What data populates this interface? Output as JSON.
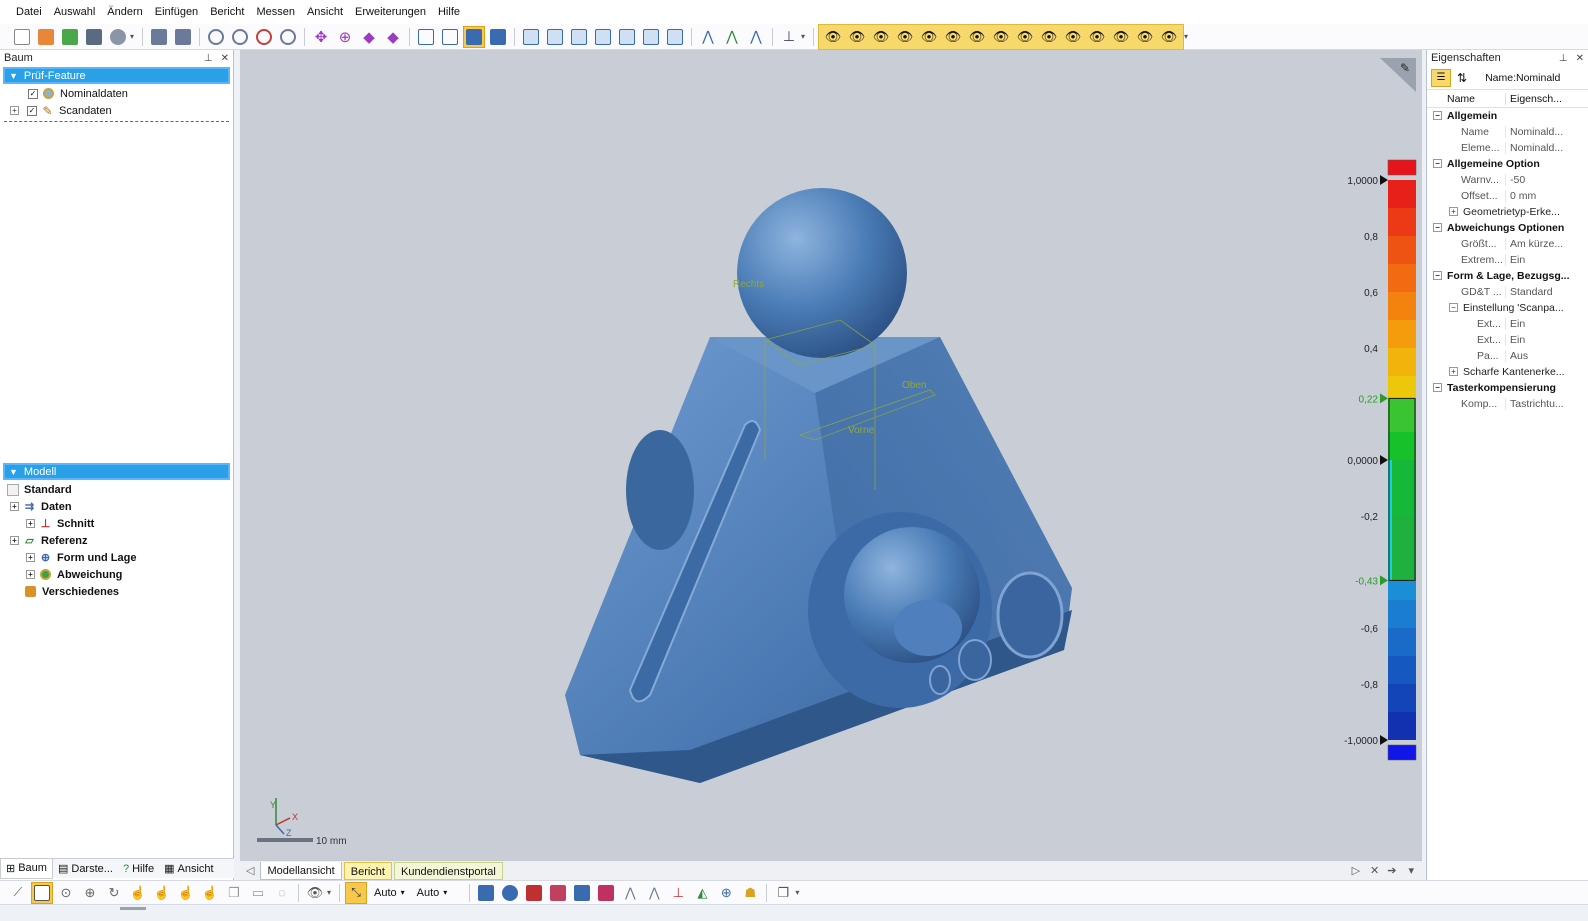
{
  "menu": [
    "Datei",
    "Auswahl",
    "Ändern",
    "Einfügen",
    "Bericht",
    "Messen",
    "Ansicht",
    "Erweiterungen",
    "Hilfe"
  ],
  "left_panel": {
    "title": "Baum",
    "section1": "Prüf-Feature",
    "tree1": [
      {
        "label": "Nominaldaten",
        "icon": "nominal-data-icon"
      },
      {
        "label": "Scandaten",
        "icon": "scan-data-icon"
      }
    ],
    "section2": "Modell",
    "tree2": [
      {
        "label": "Standard"
      },
      {
        "label": "Daten"
      },
      {
        "label": "Schnitt"
      },
      {
        "label": "Referenz"
      },
      {
        "label": "Form und Lage"
      },
      {
        "label": "Abweichung"
      },
      {
        "label": "Verschiedenes"
      }
    ],
    "tabs": [
      "Baum",
      "Darste...",
      "Hilfe",
      "Ansicht"
    ]
  },
  "viewport": {
    "labels": {
      "rechts": "Rechts",
      "oben": "Oben",
      "vorne": "Vorne"
    },
    "scale_text": "10 mm",
    "axes": {
      "x": "X",
      "y": "Y",
      "z": "Z"
    },
    "color_scale": {
      "ticks": [
        "1,0000",
        "0,8",
        "0,6",
        "0,4",
        "0,22",
        "0,0000",
        "-0,2",
        "-0,43",
        "-0,6",
        "-0,8",
        "-1,0000"
      ],
      "upper_tolerance": 0.22,
      "lower_tolerance": -0.43,
      "max": 1.0,
      "min": -1.0
    }
  },
  "view_tabs": [
    "Modellansicht",
    "Bericht",
    "Kundendienstportal"
  ],
  "properties": {
    "title": "Eigenschaften",
    "toolbar_text": "Name:Nominald",
    "col_name": "Name",
    "col_value": "Eigensch...",
    "rows": [
      {
        "type": "sec",
        "name": "Allgemein",
        "value": ""
      },
      {
        "type": "row",
        "name": "Name",
        "value": "Nominald..."
      },
      {
        "type": "row",
        "name": "Eleme...",
        "value": "Nominald..."
      },
      {
        "type": "sec",
        "name": "Allgemeine Option",
        "value": ""
      },
      {
        "type": "row",
        "name": "Warnv...",
        "value": "-50"
      },
      {
        "type": "row",
        "name": "Offset...",
        "value": "0 mm"
      },
      {
        "type": "sub",
        "name": "Geometrietyp-Erke...",
        "value": ""
      },
      {
        "type": "sec",
        "name": "Abweichungs Optionen",
        "value": ""
      },
      {
        "type": "row",
        "name": "Größt...",
        "value": "Am kürze..."
      },
      {
        "type": "row",
        "name": "Extrem...",
        "value": "Ein"
      },
      {
        "type": "sec",
        "name": "Form & Lage, Bezugsg...",
        "value": ""
      },
      {
        "type": "row",
        "name": "GD&T ...",
        "value": "Standard"
      },
      {
        "type": "subopen",
        "name": "Einstellung 'Scanpa...",
        "value": ""
      },
      {
        "type": "row2",
        "name": "Ext...",
        "value": "Ein"
      },
      {
        "type": "row2",
        "name": "Ext...",
        "value": "Ein"
      },
      {
        "type": "row2",
        "name": "Pa...",
        "value": "Aus"
      },
      {
        "type": "sub",
        "name": "Scharfe Kantenerke...",
        "value": ""
      },
      {
        "type": "sec",
        "name": "Tasterkompensierung",
        "value": ""
      },
      {
        "type": "row",
        "name": "Komp...",
        "value": "Tastrichtu..."
      }
    ]
  },
  "bottom_toolbar": {
    "dropdown1": "Auto",
    "dropdown2": "Auto"
  },
  "colors": {
    "selection": "#2aa0e6",
    "model": "#4d7fb8",
    "highlight": "#f7c84a"
  }
}
